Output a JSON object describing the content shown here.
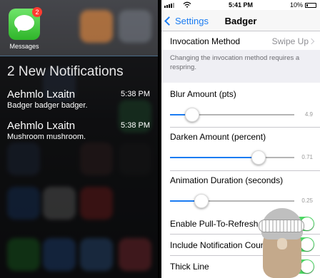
{
  "notification_center": {
    "app_label": "Messages",
    "badge_count": "2",
    "heading": "2 New Notifications",
    "notifications": [
      {
        "sender": "Aehmlo Lxaitn",
        "time": "5:38 PM",
        "body": "Badger badger badger."
      },
      {
        "sender": "Aehmlo Lxaitn",
        "time": "5:38 PM",
        "body": "Mushroom mushroom."
      }
    ]
  },
  "status_bar": {
    "time": "5:41 PM",
    "battery": "10%"
  },
  "nav": {
    "back_label": "Settings",
    "title": "Badger"
  },
  "settings": {
    "invocation_method": {
      "label": "Invocation Method",
      "value": "Swipe Up"
    },
    "respring_note": "Changing the invocation method requires a respring.",
    "sliders": [
      {
        "label": "Blur Amount (pts)",
        "value": "4.9",
        "fraction": 0.18
      },
      {
        "label": "Darken Amount (percent)",
        "value": "0.71",
        "fraction": 0.71
      },
      {
        "label": "Animation Duration (seconds)",
        "value": "0.25",
        "fraction": 0.25
      }
    ],
    "toggles": [
      {
        "label": "Enable Pull-To-Refresh",
        "on": true
      },
      {
        "label": "Include Notification Count",
        "on": true
      },
      {
        "label": "Thick Line",
        "on": true
      }
    ]
  },
  "colors": {
    "accent": "#1b7cf2",
    "toggle_on": "#4cd964",
    "badge": "#ff3b30",
    "messages_green": "#2fb52a"
  }
}
